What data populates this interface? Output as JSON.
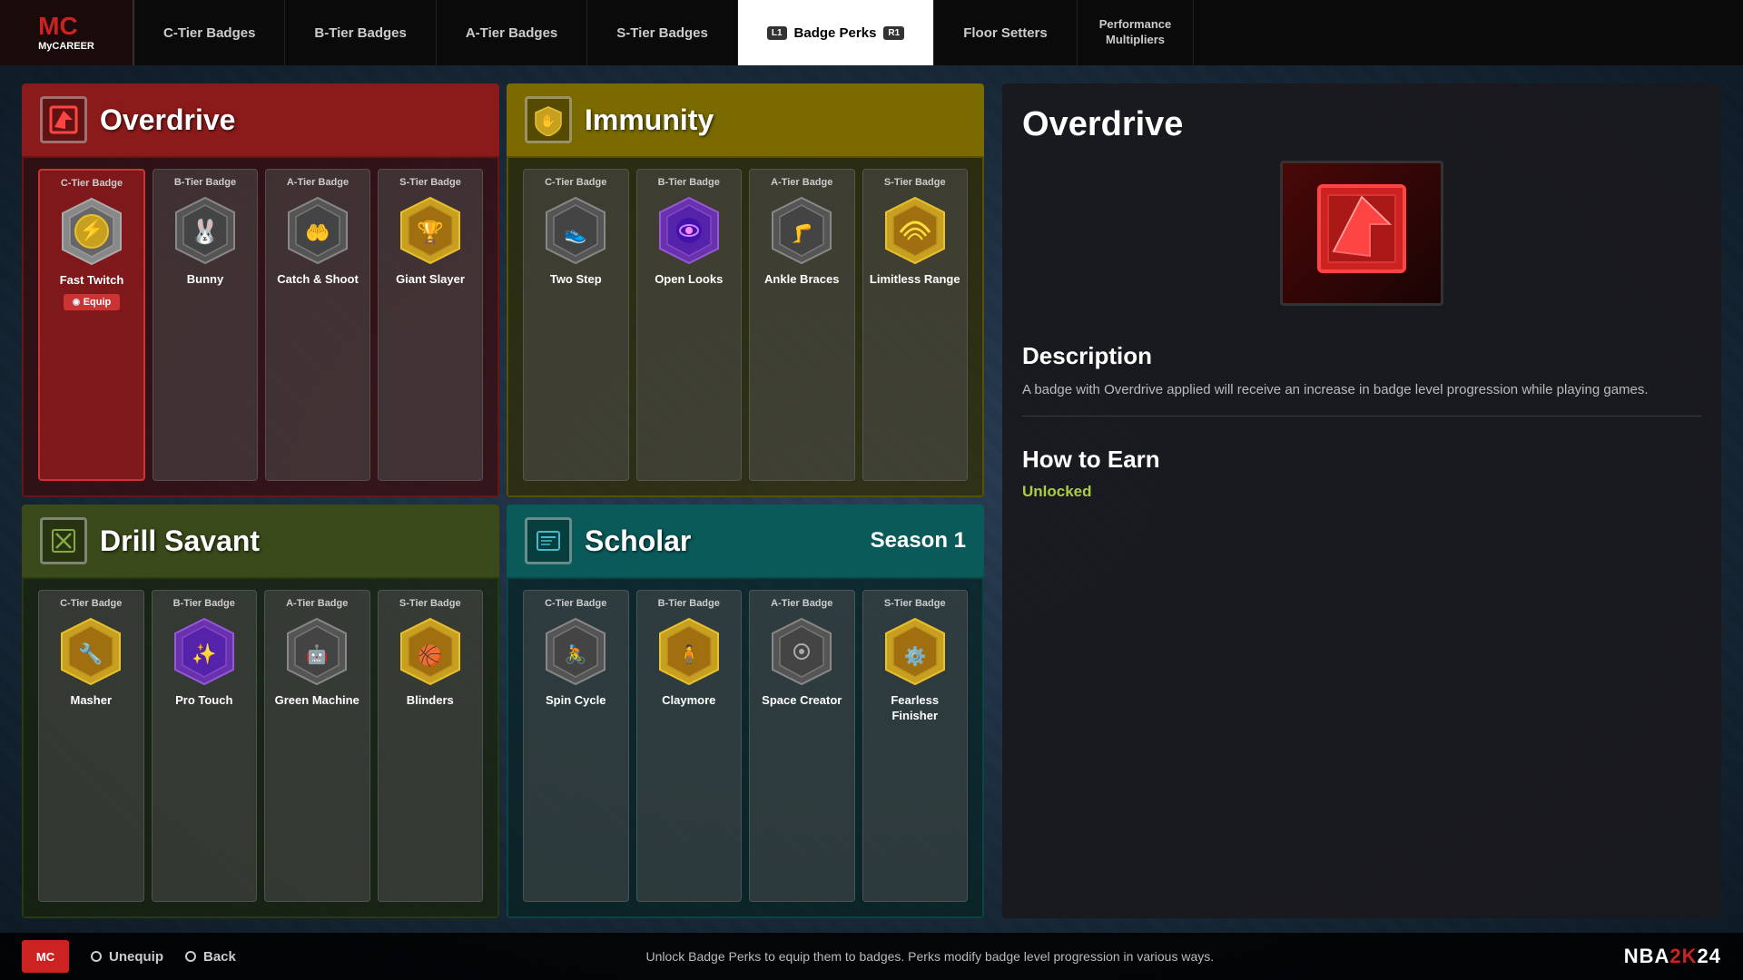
{
  "header": {
    "logo": "MyCAREER",
    "logo_short": "MC",
    "nav_tabs": [
      {
        "label": "C-Tier Badges",
        "active": false
      },
      {
        "label": "B-Tier Badges",
        "active": false
      },
      {
        "label": "A-Tier Badges",
        "active": false
      },
      {
        "label": "S-Tier Badges",
        "active": false
      },
      {
        "label": "Badge Perks",
        "active": true
      },
      {
        "label": "Floor Setters",
        "active": false
      },
      {
        "label": "Performance\nMultipliers",
        "active": false
      }
    ],
    "l1_btn": "L1",
    "r1_btn": "R1"
  },
  "panels": {
    "overdrive": {
      "title": "Overdrive",
      "header_color": "#8b1a1a",
      "badges": [
        {
          "tier": "C-Tier Badge",
          "name": "Fast Twitch",
          "selected": true,
          "equip": true
        },
        {
          "tier": "B-Tier Badge",
          "name": "Bunny",
          "selected": false
        },
        {
          "tier": "A-Tier Badge",
          "name": "Catch & Shoot",
          "selected": false
        },
        {
          "tier": "S-Tier Badge",
          "name": "Giant Slayer",
          "selected": false
        }
      ]
    },
    "immunity": {
      "title": "Immunity",
      "header_color": "#7a6a00",
      "badges": [
        {
          "tier": "C-Tier Badge",
          "name": "Two Step",
          "selected": false
        },
        {
          "tier": "B-Tier Badge",
          "name": "Open Looks",
          "selected": false
        },
        {
          "tier": "A-Tier Badge",
          "name": "Ankle Braces",
          "selected": false
        },
        {
          "tier": "S-Tier Badge",
          "name": "Limitless Range",
          "selected": false
        }
      ]
    },
    "drill_savant": {
      "title": "Drill Savant",
      "header_color": "#3a4a1a",
      "badges": [
        {
          "tier": "C-Tier Badge",
          "name": "Masher",
          "selected": false
        },
        {
          "tier": "B-Tier Badge",
          "name": "Pro Touch",
          "selected": false
        },
        {
          "tier": "A-Tier Badge",
          "name": "Green Machine",
          "selected": false
        },
        {
          "tier": "S-Tier Badge",
          "name": "Blinders",
          "selected": false
        }
      ]
    },
    "scholar": {
      "title": "Scholar",
      "season": "Season 1",
      "header_color": "#0a5a5a",
      "badges": [
        {
          "tier": "C-Tier Badge",
          "name": "Spin Cycle",
          "selected": false
        },
        {
          "tier": "B-Tier Badge",
          "name": "Claymore",
          "selected": false
        },
        {
          "tier": "A-Tier Badge",
          "name": "Space Creator",
          "selected": false
        },
        {
          "tier": "S-Tier Badge",
          "name": "Fearless Finisher",
          "selected": false
        }
      ]
    }
  },
  "detail": {
    "title": "Overdrive",
    "description_title": "Description",
    "description": "A badge with Overdrive applied will receive an increase in badge level progression while playing games.",
    "earn_title": "How to Earn",
    "earn_status": "Unlocked"
  },
  "footer": {
    "unequip_label": "Unequip",
    "back_label": "Back",
    "hint": "Unlock Badge Perks to equip them to badges. Perks modify badge level progression in various ways.",
    "brand": "NBA2K24"
  }
}
